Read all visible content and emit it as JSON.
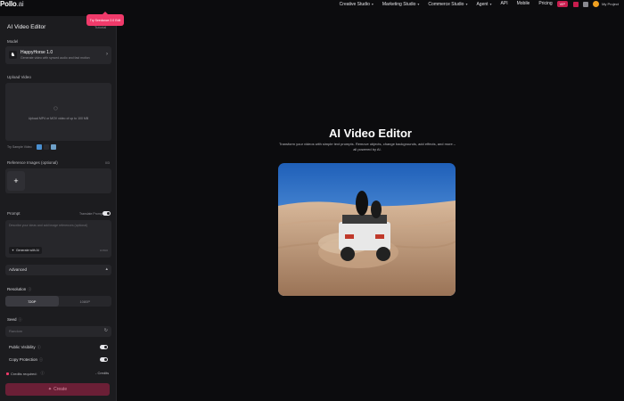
{
  "brand": {
    "name": "Pollo",
    "suffix": ".ai"
  },
  "nav": {
    "items": [
      "Creative Studio",
      "Marketing Studio",
      "Commerce Studio",
      "Agent"
    ],
    "links": [
      "API",
      "Mobile",
      "Pricing"
    ],
    "badge": "VIP",
    "user": "My Project"
  },
  "panel": {
    "title": "AI Video Editor",
    "help": "Tutorial",
    "tooltip": "Try Seedance 2.0 Edit",
    "model": {
      "label": "Model",
      "name": "HappyHorse 1.0",
      "description": "Generate video with synced audio and fast motion"
    },
    "upload": {
      "label": "Upload Video",
      "hint": "Upload MP4 or MOV video of up to 100 MB"
    },
    "sample_label": "Try Sample Video",
    "reference": {
      "label": "Reference Images (optional)",
      "count": "0/3"
    },
    "prompt": {
      "label": "Prompt",
      "translate_label": "Translate Prompt",
      "placeholder": "Describe your ideas and add image references (optional)",
      "generate_label": "Generate with AI",
      "char_count": "0/1500"
    },
    "advanced_label": "Advanced",
    "resolution": {
      "label": "Resolution",
      "options": [
        "720P",
        "1080P"
      ],
      "selected": "720P"
    },
    "seed": {
      "label": "Seed",
      "placeholder": "Random"
    },
    "public_visibility": "Public Visibility",
    "copy_protection": "Copy Protection",
    "credits_label": "Credits required:",
    "credits_value": "- Credits",
    "create_label": "Create"
  },
  "hero": {
    "title": "AI Video Editor",
    "subtitle": "Transform your videos with simple text prompts. Remove objects, change backgrounds, add effects, and more – all powered by AI."
  },
  "colors": {
    "accent": "#f03a6a",
    "create_button": "#6b1f36",
    "panel_bg": "#1c1c1f",
    "page_bg": "#0c0c0e"
  }
}
